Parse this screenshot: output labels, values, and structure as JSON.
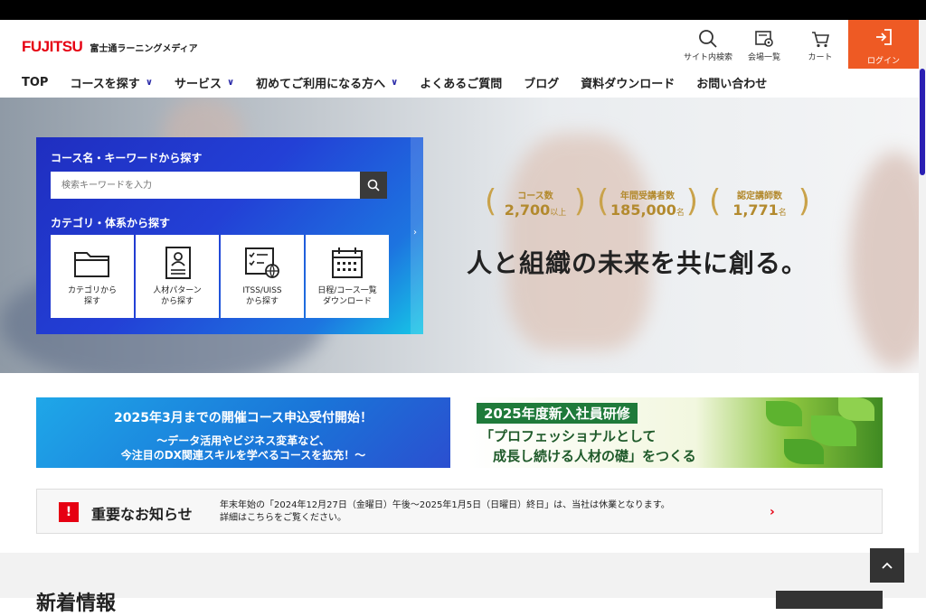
{
  "header": {
    "brand": "FUJITSU",
    "brand_sub": "富士通ラーニングメディア",
    "icons": {
      "search": "サイト内検索",
      "venue": "会場一覧",
      "cart": "カート"
    },
    "login": "ログイン"
  },
  "nav": {
    "top": "TOP",
    "course": "コースを探す",
    "service": "サービス",
    "first_time": "初めてご利用になる方へ",
    "faq": "よくあるご質問",
    "blog": "ブログ",
    "download": "資料ダウンロード",
    "contact": "お問い合わせ"
  },
  "search": {
    "title": "コース名・キーワードから探す",
    "placeholder": "検索キーワードを入力",
    "category_title": "カテゴリ・体系から探す",
    "tiles": [
      {
        "line1": "カテゴリから",
        "line2": "探す"
      },
      {
        "line1": "人材パターン",
        "line2": "から探す"
      },
      {
        "line1": "ITSS/UISS",
        "line2": "から探す"
      },
      {
        "line1": "日程/コース一覧",
        "line2": "ダウンロード"
      }
    ]
  },
  "stats": [
    {
      "label": "コース数",
      "value": "2,700",
      "unit": "以上"
    },
    {
      "label": "年間受講者数",
      "value": "185,000",
      "unit": "名"
    },
    {
      "label": "認定講師数",
      "value": "1,771",
      "unit": "名"
    }
  ],
  "tagline": "人と組織の未来を共に創る。",
  "banner1": {
    "line1": "2025年3月までの開催コース申込受付開始！",
    "line2": "～データ活用やビジネス変革など、",
    "line3": "今注目のDX関連スキルを学べるコースを拡充！～"
  },
  "banner2": {
    "badge": "2025年度新入社員研修",
    "line1": "「プロフェッショナルとして",
    "line2": "成長し続ける人材の礎」をつくる"
  },
  "notice": {
    "title": "重要なお知らせ",
    "line1": "年末年始の「2024年12月27日（金曜日）午後～2025年1月5日（日曜日）終日」は、当社は休業となります。",
    "line2": "詳細はこちらをご覧ください。"
  },
  "bottom": {
    "heading": "新着情報"
  },
  "colors": {
    "brand_red": "#e60012",
    "login_orange": "#ee5a24",
    "nav_accent": "#2a2aa8",
    "gold": "#b38a2e"
  }
}
